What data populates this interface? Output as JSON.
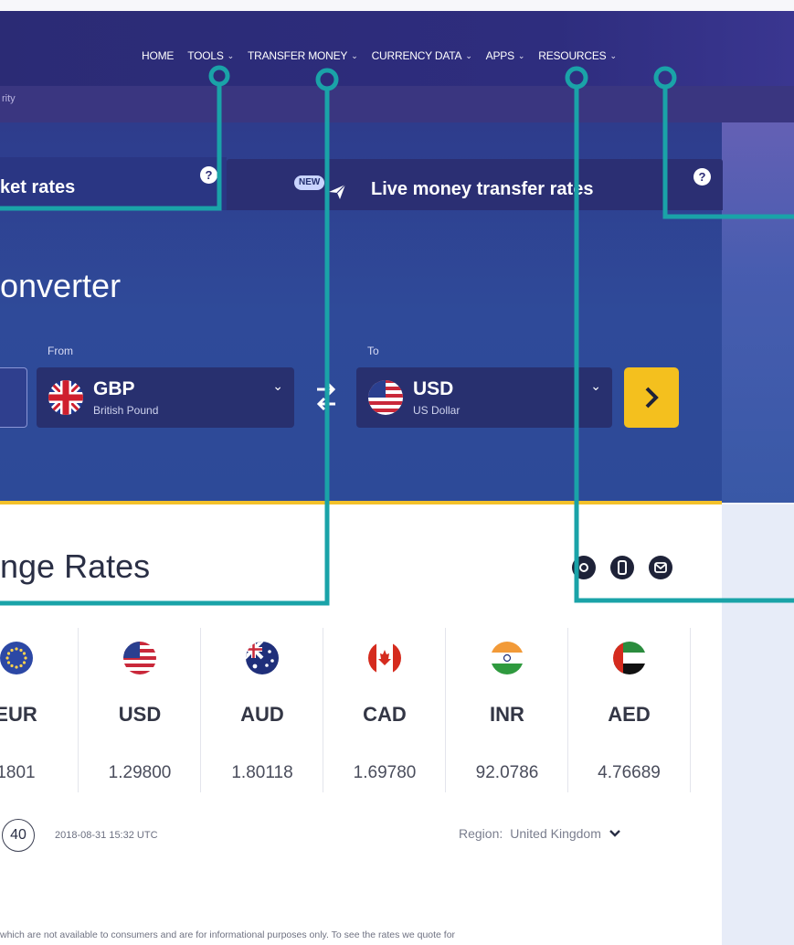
{
  "nav": {
    "items": [
      {
        "label": "HOME",
        "chevron": false
      },
      {
        "label": "TOOLS",
        "chevron": true
      },
      {
        "label": "TRANSFER MONEY",
        "chevron": true
      },
      {
        "label": "CURRENCY DATA",
        "chevron": true
      },
      {
        "label": "APPS",
        "chevron": true
      },
      {
        "label": "RESOURCES",
        "chevron": true
      }
    ]
  },
  "subnav": {
    "text": "rity"
  },
  "tabs": {
    "market_label": "ket rates",
    "live_label": "Live money transfer rates",
    "new_badge": "NEW"
  },
  "converter": {
    "title": "onverter",
    "from_label": "From",
    "to_label": "To",
    "from": {
      "code": "GBP",
      "name": "British Pound"
    },
    "to": {
      "code": "USD",
      "name": "US Dollar"
    }
  },
  "rates": {
    "title": "nge Rates",
    "columns": [
      {
        "code": "EUR",
        "value": "1801",
        "flag": "eu-flag-icon"
      },
      {
        "code": "USD",
        "value": "1.29800",
        "flag": "us-flag-icon"
      },
      {
        "code": "AUD",
        "value": "1.80118",
        "flag": "au-flag-icon"
      },
      {
        "code": "CAD",
        "value": "1.69780",
        "flag": "ca-flag-icon"
      },
      {
        "code": "INR",
        "value": "92.0786",
        "flag": "in-flag-icon"
      },
      {
        "code": "AED",
        "value": "4.76689",
        "flag": "ae-flag-icon"
      }
    ],
    "count_badge": "40",
    "timestamp": "2018-08-31 15:32 UTC",
    "region_label": "Region:",
    "region_value": "United Kingdom"
  },
  "disclaimer": "which are not available to consumers and are for informational purposes only. To see the rates we quote for",
  "colors": {
    "nav_bg": "#2b2b75",
    "hero_bg": "#2e3c8c",
    "accent_yellow": "#f4c01e",
    "callout_teal": "#1aa3a8"
  }
}
